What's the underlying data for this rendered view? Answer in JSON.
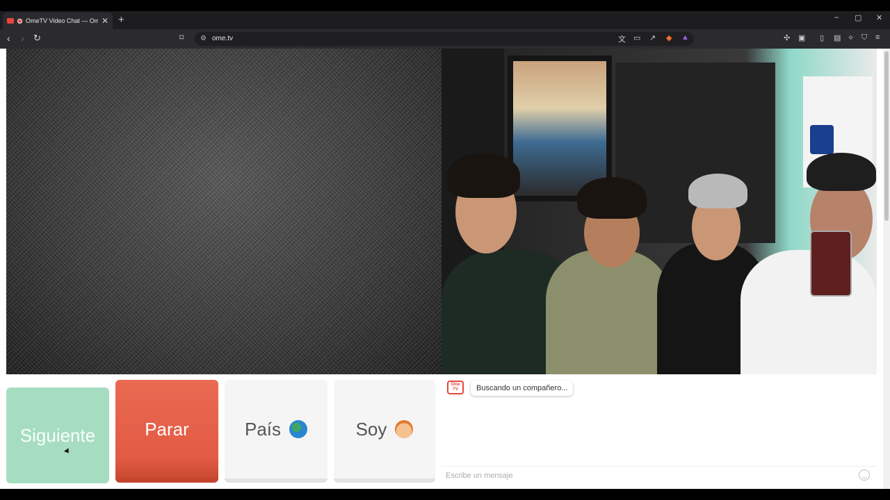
{
  "browser": {
    "tab_title": "OmeTV Video Chat — Omeg",
    "tab_close": "✕",
    "new_tab": "+",
    "url": "ome.tv",
    "window_controls": [
      "–",
      "▢",
      "✕"
    ]
  },
  "controls": {
    "next_label": "Siguiente",
    "stop_label": "Parar",
    "country_label": "País",
    "gender_label": "Soy"
  },
  "chat": {
    "logo_text": "Ome TV",
    "status_message": "Buscando un compañero...",
    "input_placeholder": "Escribe un mensaje"
  },
  "colors": {
    "next": "#a6ddc0",
    "stop": "#e25a44",
    "neutral": "#f5f5f5",
    "brand": "#e8453c"
  },
  "icons": {
    "back": "arrow-left-icon",
    "forward": "arrow-right-icon",
    "reload": "reload-icon",
    "bookmark": "bookmark-icon",
    "site_info": "site-settings-icon",
    "translate": "translate-icon",
    "cast": "cast-icon",
    "share": "share-icon",
    "brave_shield": "brave-shield-icon",
    "brave_rewards": "brave-rewards-icon",
    "extensions": "extensions-icon",
    "sidebar": "sidebar-icon",
    "wallet": "wallet-icon",
    "leo": "leo-ai-icon",
    "vpn": "vpn-icon",
    "menu": "menu-icon",
    "emoji": "emoji-icon"
  }
}
